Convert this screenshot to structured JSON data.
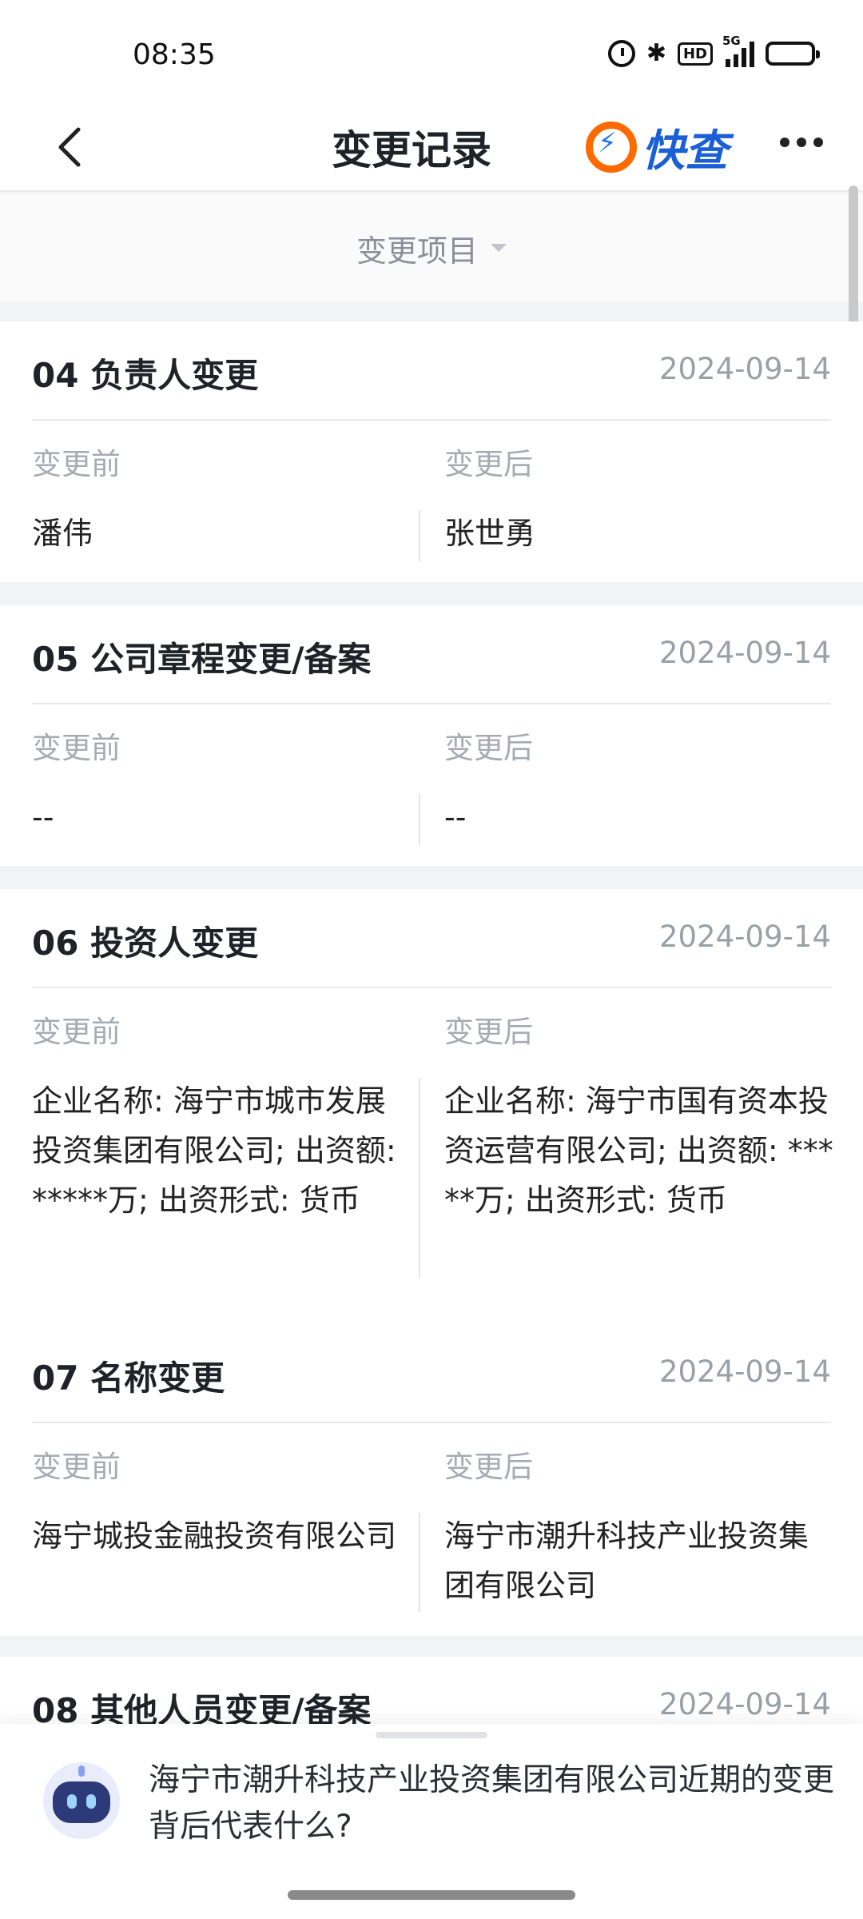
{
  "status": {
    "time": "08:35",
    "network": "5G"
  },
  "nav": {
    "title": "变更记录",
    "logo_text": "快查"
  },
  "filter": {
    "label": "变更项目"
  },
  "labels": {
    "before": "变更前",
    "after": "变更后"
  },
  "records": [
    {
      "title": "04 负责人变更",
      "date": "2024-09-14",
      "before": "潘伟",
      "after": "张世勇"
    },
    {
      "title": "05 公司章程变更/备案",
      "date": "2024-09-14",
      "before": "--",
      "after": "--"
    },
    {
      "title": "06 投资人变更",
      "date": "2024-09-14",
      "before": "企业名称: 海宁市城市发展投资集团有限公司; 出资额: *****万; 出资形式: 货币",
      "after": "企业名称: 海宁市国有资本投资运营有限公司; 出资额: *****万; 出资形式: 货币"
    },
    {
      "title": "07 名称变更",
      "date": "2024-09-14",
      "before": "海宁城投金融投资有限公司",
      "after": "海宁市潮升科技产业投资集团有限公司"
    },
    {
      "title": "08 其他人员变更/备案",
      "date": "2024-09-14"
    }
  ],
  "ai": {
    "question": "海宁市潮升科技产业投资集团有限公司近期的变更背后代表什么?"
  },
  "colors": {
    "accent_orange": "#ff6a00",
    "accent_blue": "#1a5fd6"
  }
}
